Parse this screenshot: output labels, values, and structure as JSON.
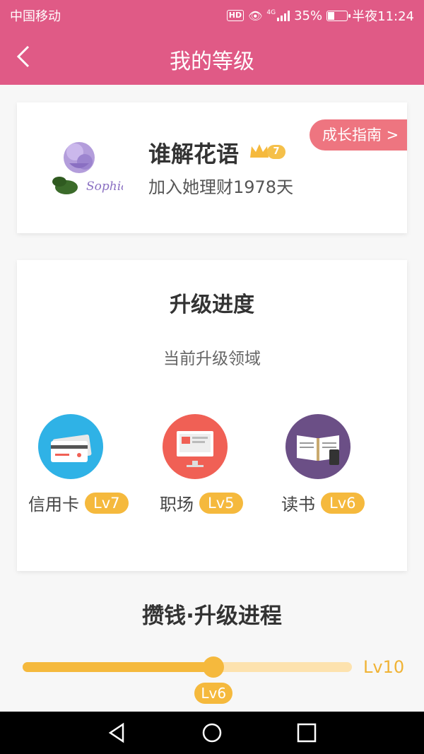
{
  "status_bar": {
    "carrier": "中国移动",
    "hd": "HD",
    "network": "4G",
    "battery": "35%",
    "time": "半夜11:24"
  },
  "nav": {
    "title": "我的等级"
  },
  "profile": {
    "avatar_signature": "Sophia",
    "username": "谁解花语",
    "crown_level": "7",
    "joined_text": "加入她理财1978天",
    "guide_button": "成长指南 >"
  },
  "progress": {
    "title": "升级进度",
    "subtitle": "当前升级领域",
    "fields": [
      {
        "label": "信用卡",
        "level": "Lv7",
        "icon": "credit-card-icon",
        "color": "#2fb2e6"
      },
      {
        "label": "职场",
        "level": "Lv5",
        "icon": "computer-monitor-icon",
        "color": "#f06055"
      },
      {
        "label": "读书",
        "level": "Lv6",
        "icon": "open-book-icon",
        "color": "#6b4f86"
      }
    ]
  },
  "journey": {
    "title": "攒钱·升级进程",
    "current_level": "Lv6",
    "max_level": "Lv10",
    "progress": 0.58
  },
  "colors": {
    "header": "#e05a86",
    "accent": "#f5b93d",
    "guide": "#ee7580"
  }
}
